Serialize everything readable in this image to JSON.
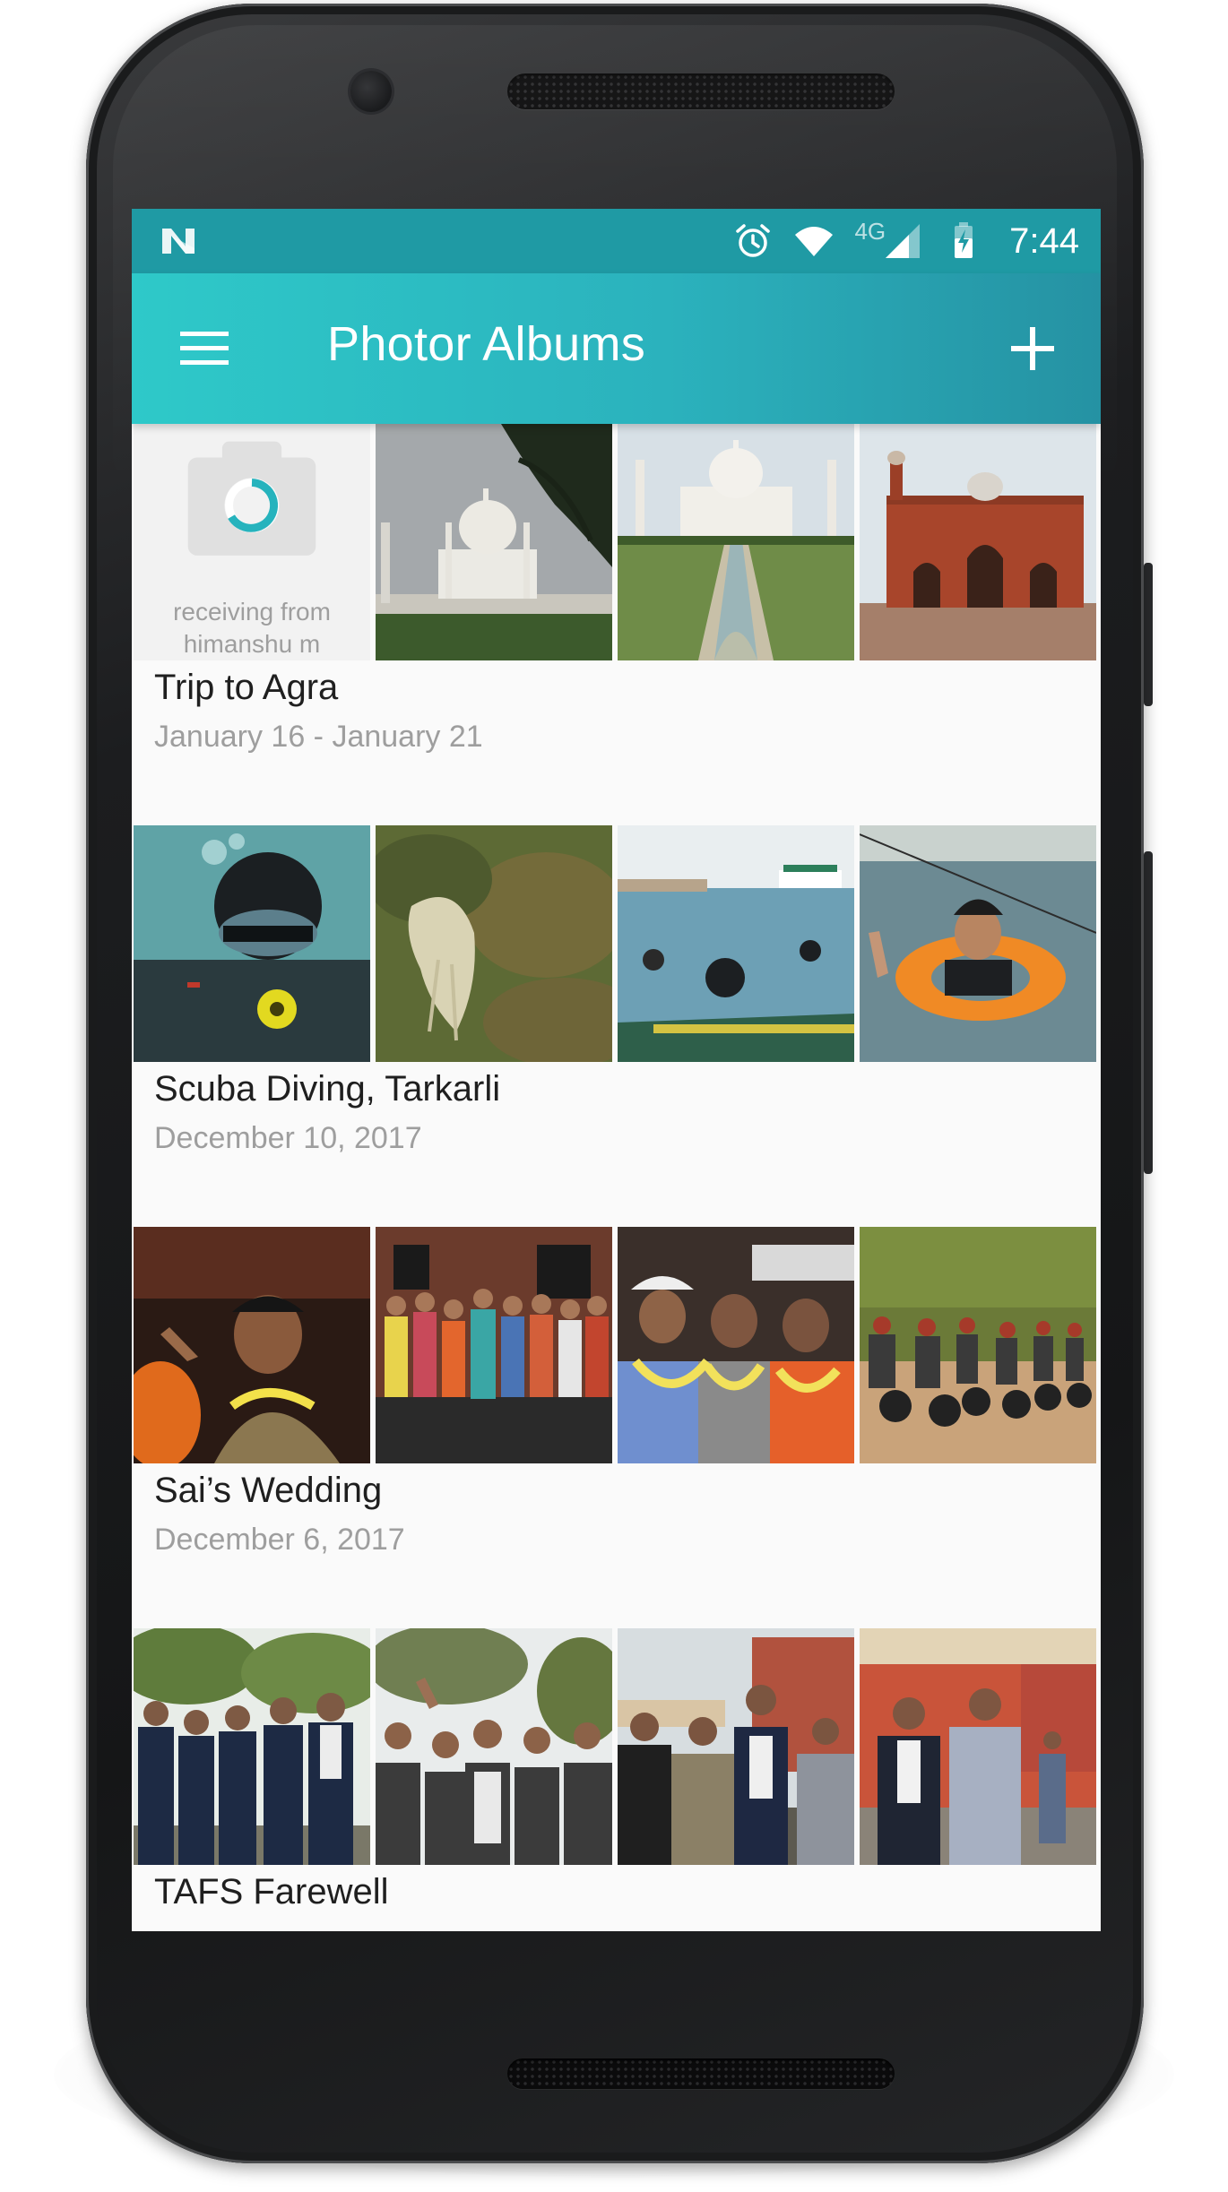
{
  "status_bar": {
    "time": "7:44",
    "network_label": "4G",
    "icons": [
      "notification-n-icon",
      "alarm-icon",
      "wifi-icon",
      "cell-signal-icon",
      "battery-charging-icon"
    ]
  },
  "app_bar": {
    "title": "Photor Albums",
    "menu_icon": "hamburger-menu-icon",
    "action_icon": "add-icon"
  },
  "colors": {
    "status_bar": "#1f9aa4",
    "app_bar_start": "#2ec9c9",
    "app_bar_end": "#2592a3",
    "background": "#fafafa",
    "title_text": "#1f1f1f",
    "date_text": "#9e9e9e"
  },
  "albums": [
    {
      "title": "Trip to Agra",
      "date": "January 16 - January 21",
      "receiving": {
        "line1": "receiving from",
        "line2": "himanshu m",
        "icon": "camera-progress-icon"
      },
      "photos": [
        "taj-mahal-under-trees",
        "taj-mahal-reflecting-pool",
        "red-sandstone-mosque"
      ]
    },
    {
      "title": "Scuba Diving, Tarkarli",
      "date": "December 10, 2017",
      "photos": [
        "diver-underwater",
        "jellyfish-underwater",
        "divers-near-boat",
        "swimmer-with-ring"
      ]
    },
    {
      "title": "Sai’s Wedding",
      "date": "December 6, 2017",
      "photos": [
        "dancing-at-party",
        "group-with-garlands",
        "friends-with-garlands",
        "motorbike-riders"
      ]
    },
    {
      "title": "TAFS Farewell",
      "date": "",
      "photos": [
        "group-in-suits-park",
        "cheering-group",
        "friends-by-building",
        "friends-posing-campus"
      ]
    }
  ]
}
